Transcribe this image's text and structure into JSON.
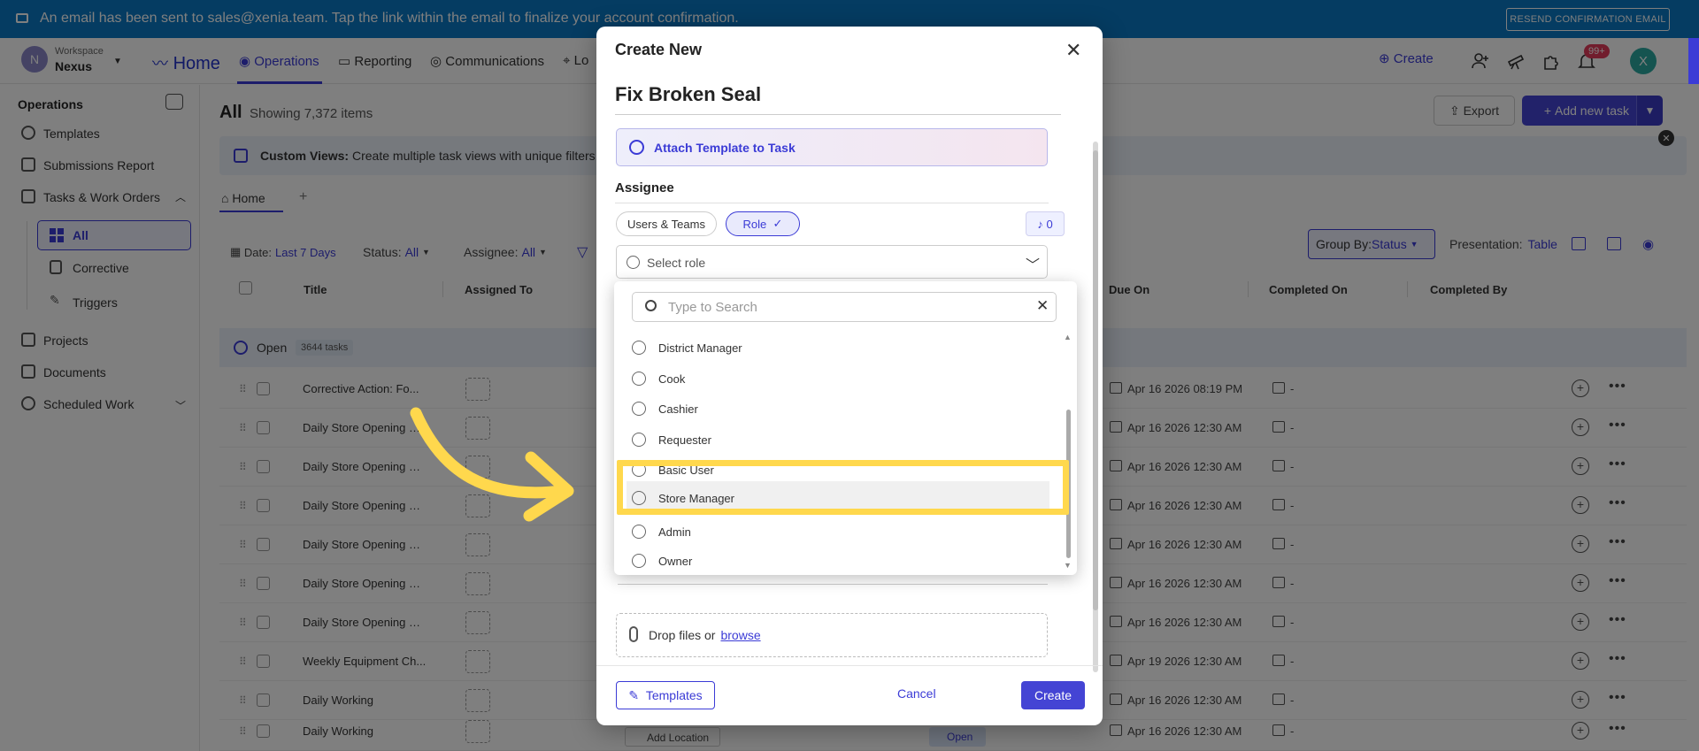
{
  "banner": {
    "message": "An email has been sent to sales@xenia.team. Tap the link within the email to finalize your account confirmation.",
    "resend_label": "RESEND CONFIRMATION EMAIL"
  },
  "topnav": {
    "workspace_initial": "N",
    "workspace_label": "Workspace",
    "workspace_name": "Nexus",
    "home": "Home",
    "items": [
      "Operations",
      "Reporting",
      "Communications",
      "Lo"
    ],
    "create_label": "Create",
    "notification_count": "99+",
    "user_initial": "X"
  },
  "sidebar": {
    "section": "Operations",
    "items": [
      "Templates",
      "Submissions Report",
      "Tasks & Work Orders",
      "All",
      "Corrective",
      "Triggers",
      "Projects",
      "Documents",
      "Scheduled Work"
    ]
  },
  "content": {
    "title": "All",
    "subtitle": "Showing 7,372 items",
    "export_label": "Export",
    "add_task_label": "Add new task",
    "info_title": "Custom Views:",
    "info_text": "Create multiple task views with unique filters. T",
    "tab_home": "Home",
    "filters": {
      "date_label": "Date:",
      "date_value": "Last 7 Days",
      "status_label": "Status:",
      "status_value": "All",
      "assignee_label": "Assignee:",
      "assignee_value": "All"
    },
    "group_by_label": "Group By:",
    "group_by_value": "Status",
    "presentation_label": "Presentation:",
    "presentation_value": "Table",
    "columns": [
      "Title",
      "Assigned To",
      "Due On",
      "Completed On",
      "Completed By"
    ],
    "group": {
      "label": "Open",
      "count": "3644 tasks"
    },
    "rows": [
      {
        "title": "Corrective Action: Fo...",
        "due": "Apr 16 2026 08:19 PM",
        "completed": "-"
      },
      {
        "title": "Daily Store Opening C...",
        "due": "Apr 16 2026 12:30 AM",
        "completed": "-"
      },
      {
        "title": "Daily Store Opening C...",
        "due": "Apr 16 2026 12:30 AM",
        "completed": "-"
      },
      {
        "title": "Daily Store Opening C...",
        "due": "Apr 16 2026 12:30 AM",
        "completed": "-"
      },
      {
        "title": "Daily Store Opening C...",
        "due": "Apr 16 2026 12:30 AM",
        "completed": "-"
      },
      {
        "title": "Daily Store Opening C...",
        "due": "Apr 16 2026 12:30 AM",
        "completed": "-"
      },
      {
        "title": "Daily Store Opening C...",
        "due": "Apr 16 2026 12:30 AM",
        "completed": "-"
      },
      {
        "title": "Weekly Equipment Ch...",
        "due": "Apr 19 2026 12:30 AM",
        "completed": "-"
      },
      {
        "title": "Daily Working",
        "due": "Apr 16 2026 12:30 AM",
        "completed": "-"
      },
      {
        "title": "Daily Working",
        "due": "Apr 16 2026 12:30 AM",
        "completed": "-"
      }
    ],
    "row_footer": {
      "location": "Add Location",
      "status": "Open"
    }
  },
  "modal": {
    "title": "Create New",
    "task_name": "Fix Broken Seal",
    "attach_template": "Attach Template to Task",
    "assignee_heading": "Assignee",
    "tab_users": "Users & Teams",
    "tab_role": "Role",
    "notify_count": "0",
    "select_placeholder": "Select role",
    "drop_files": "Drop files or",
    "browse": "browse",
    "templates_label": "Templates",
    "cancel_label": "Cancel",
    "create_label": "Create"
  },
  "dropdown": {
    "search_placeholder": "Type to Search",
    "roles": [
      "District Manager",
      "Cook",
      "Cashier",
      "Requester",
      "Basic User",
      "Store Manager",
      "Admin",
      "Owner"
    ],
    "highlighted": "Store Manager"
  },
  "colors": {
    "accent": "#3b3bd6",
    "banner": "#0b79c4",
    "highlight": "#ffd84d"
  }
}
